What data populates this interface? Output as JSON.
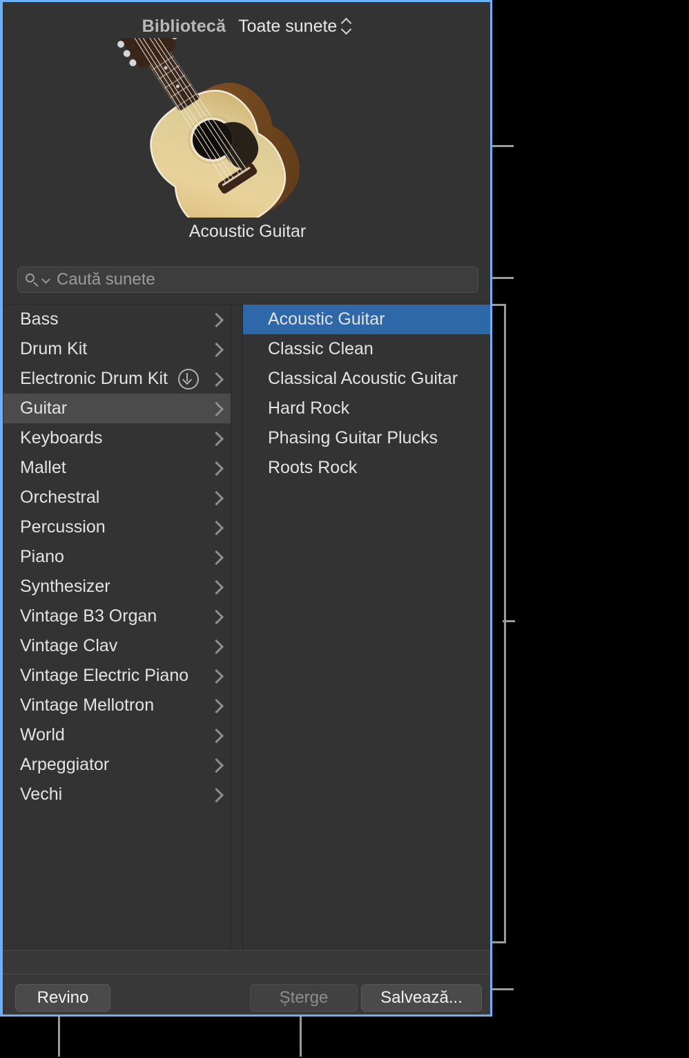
{
  "window": {
    "header": {
      "library_label": "Bibliotecă",
      "selector_label": "Toate sunete",
      "selector_icon": "updown-stepper-icon"
    },
    "patch": {
      "artwork_icon": "acoustic-guitar-image",
      "name": "Acoustic Guitar"
    },
    "search": {
      "placeholder": "Caută sunete",
      "value": "",
      "search_icon": "search-icon",
      "menu_icon": "chevron-down-icon"
    },
    "categories": [
      {
        "label": "Bass",
        "disclosure": "chevron-right-icon",
        "download": false,
        "selected": false
      },
      {
        "label": "Drum Kit",
        "disclosure": "chevron-right-icon",
        "download": false,
        "selected": false
      },
      {
        "label": "Electronic Drum Kit",
        "disclosure": "chevron-right-icon",
        "download": true,
        "download_icon": "download-circle-icon",
        "selected": false
      },
      {
        "label": "Guitar",
        "disclosure": "chevron-right-icon",
        "download": false,
        "selected": true
      },
      {
        "label": "Keyboards",
        "disclosure": "chevron-right-icon",
        "download": false,
        "selected": false
      },
      {
        "label": "Mallet",
        "disclosure": "chevron-right-icon",
        "download": false,
        "selected": false
      },
      {
        "label": "Orchestral",
        "disclosure": "chevron-right-icon",
        "download": false,
        "selected": false
      },
      {
        "label": "Percussion",
        "disclosure": "chevron-right-icon",
        "download": false,
        "selected": false
      },
      {
        "label": "Piano",
        "disclosure": "chevron-right-icon",
        "download": false,
        "selected": false
      },
      {
        "label": "Synthesizer",
        "disclosure": "chevron-right-icon",
        "download": false,
        "selected": false
      },
      {
        "label": "Vintage B3 Organ",
        "disclosure": "chevron-right-icon",
        "download": false,
        "selected": false
      },
      {
        "label": "Vintage Clav",
        "disclosure": "chevron-right-icon",
        "download": false,
        "selected": false
      },
      {
        "label": "Vintage Electric Piano",
        "disclosure": "chevron-right-icon",
        "download": false,
        "selected": false
      },
      {
        "label": "Vintage Mellotron",
        "disclosure": "chevron-right-icon",
        "download": false,
        "selected": false
      },
      {
        "label": "World",
        "disclosure": "chevron-right-icon",
        "download": false,
        "selected": false
      },
      {
        "label": "Arpeggiator",
        "disclosure": "chevron-right-icon",
        "download": false,
        "selected": false
      },
      {
        "label": "Vechi",
        "disclosure": "chevron-right-icon",
        "download": false,
        "selected": false
      }
    ],
    "patches": [
      {
        "label": "Acoustic Guitar",
        "selected": true
      },
      {
        "label": "Classic Clean",
        "selected": false
      },
      {
        "label": "Classical Acoustic Guitar",
        "selected": false
      },
      {
        "label": "Hard Rock",
        "selected": false
      },
      {
        "label": "Phasing Guitar Plucks",
        "selected": false
      },
      {
        "label": "Roots Rock",
        "selected": false
      }
    ],
    "footer": {
      "revert_label": "Revino",
      "delete_label": "Șterge",
      "delete_disabled": true,
      "save_label": "Salvează..."
    }
  },
  "colors": {
    "selection_blue": "#2f68a8",
    "window_border": "#6eb0f5",
    "panel_bg": "#333333",
    "row_selected_grey": "#4b4b4b",
    "callout_line": "#9a9a9a"
  }
}
